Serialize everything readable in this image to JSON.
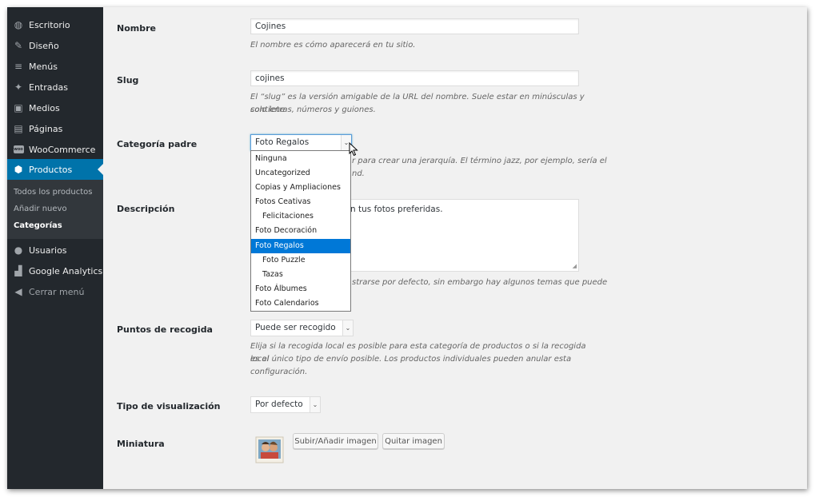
{
  "sidebar": {
    "items": [
      {
        "label": "Escritorio",
        "icon": "dashboard-icon",
        "glyph": "◍"
      },
      {
        "label": "Diseño",
        "icon": "paintbrush-icon",
        "glyph": "✎"
      },
      {
        "label": "Menús",
        "icon": "menu-icon",
        "glyph": "≡"
      },
      {
        "label": "Entradas",
        "icon": "pushpin-icon",
        "glyph": "✦"
      },
      {
        "label": "Medios",
        "icon": "media-icon",
        "glyph": "▣"
      },
      {
        "label": "Páginas",
        "icon": "pages-icon",
        "glyph": "▤"
      },
      {
        "label": "WooCommerce",
        "icon": "woocommerce-icon",
        "glyph": "woo"
      },
      {
        "label": "Productos",
        "icon": "products-cube-icon",
        "glyph": "⬢"
      },
      {
        "label": "Usuarios",
        "icon": "users-icon",
        "glyph": "●"
      },
      {
        "label": "Google Analytics",
        "icon": "analytics-chart-icon",
        "glyph": "▟"
      },
      {
        "label": "Cerrar menú",
        "icon": "collapse-menu-icon",
        "glyph": "◀"
      }
    ],
    "submenu": [
      "Todos los productos",
      "Añadir nuevo",
      "Categorías"
    ]
  },
  "form": {
    "name_label": "Nombre",
    "name_value": "Cojines",
    "name_desc": "El nombre es cómo aparecerá en tu sitio.",
    "slug_label": "Slug",
    "slug_value": "cojines",
    "slug_desc_1": "El “slug” es la versión amigable de la URL del nombre. Suele estar en minúsculas y contiene",
    "slug_desc_2": "solo letras, números y guiones.",
    "parent_label": "Categoría padre",
    "parent_value": "Foto Regalos",
    "parent_desc_1": "r para crear una jerarquía. El término jazz, por ejemplo, sería el",
    "parent_desc_2": "nd.",
    "parent_options": [
      "Ninguna",
      "Uncategorized",
      "Copias y Ampliaciones",
      "Fotos Ceativas",
      "Felicitaciones",
      "Foto Decoración",
      "Foto Regalos",
      "Foto Puzzle",
      "Tazas",
      "Foto Álbumes",
      "Foto Calendarios"
    ],
    "parent_selected_index": 6,
    "desc_label": "Descripción",
    "desc_value": "n tus fotos preferidas.",
    "desc_hint": "strarse por defecto, sin embargo hay algunos temas que puede",
    "pickup_label": "Puntos de recogida",
    "pickup_value": "Puede ser recogido",
    "pickup_desc_1": "Elija si la recogida local es posible para esta categoría de productos o si la recogida local",
    "pickup_desc_2": "es el único tipo de envío posible. Los productos individuales pueden anular esta",
    "pickup_desc_3": "configuración.",
    "display_label": "Tipo de visualización",
    "display_value": "Por defecto",
    "thumb_label": "Miniatura",
    "upload_btn": "Subir/Añadir imagen",
    "remove_btn": "Quitar imagen"
  },
  "colors": {
    "sidebar": "#23282d",
    "accent": "#0073aa",
    "selected": "#0078d7"
  }
}
